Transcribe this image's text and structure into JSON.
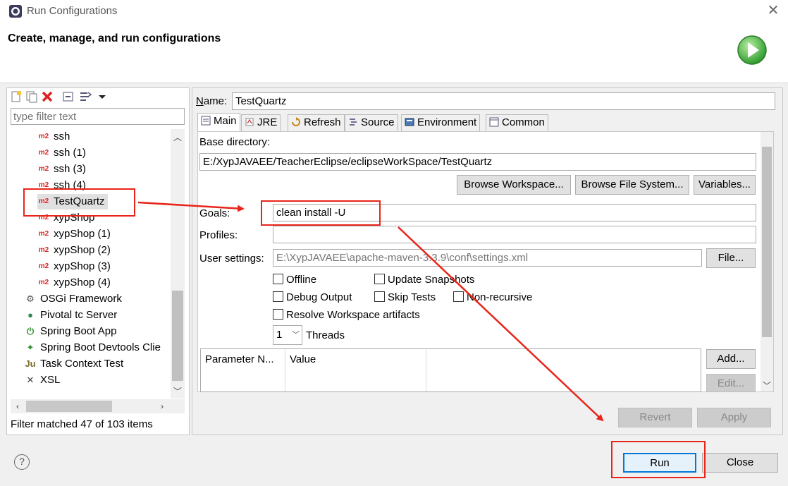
{
  "window": {
    "title": "Run Configurations",
    "header": "Create, manage, and run configurations",
    "close_glyph": "✕"
  },
  "left": {
    "filter_placeholder": "type filter text",
    "filter_status": "Filter matched 47 of 103 items",
    "tree": [
      {
        "label": "ssh",
        "icon": "maven-m2-icon",
        "indent": 1
      },
      {
        "label": "ssh (1)",
        "icon": "maven-m2-icon",
        "indent": 1
      },
      {
        "label": "ssh (3)",
        "icon": "maven-m2-icon",
        "indent": 1
      },
      {
        "label": "ssh (4)",
        "icon": "maven-m2-icon",
        "indent": 1
      },
      {
        "label": "TestQuartz",
        "icon": "maven-m2-icon",
        "indent": 1,
        "selected": true
      },
      {
        "label": "xypShop",
        "icon": "maven-m2-icon",
        "indent": 1
      },
      {
        "label": "xypShop (1)",
        "icon": "maven-m2-icon",
        "indent": 1
      },
      {
        "label": "xypShop (2)",
        "icon": "maven-m2-icon",
        "indent": 1
      },
      {
        "label": "xypShop (3)",
        "icon": "maven-m2-icon",
        "indent": 1
      },
      {
        "label": "xypShop (4)",
        "icon": "maven-m2-icon",
        "indent": 1
      },
      {
        "label": "OSGi Framework",
        "icon": "osgi-icon",
        "indent": 0
      },
      {
        "label": "Pivotal tc Server",
        "icon": "pivotal-icon",
        "indent": 0
      },
      {
        "label": "Spring Boot App",
        "icon": "spring-boot-icon",
        "indent": 0
      },
      {
        "label": "Spring Boot Devtools Clie",
        "icon": "spring-devtools-icon",
        "indent": 0
      },
      {
        "label": "Task Context Test",
        "icon": "junit-icon",
        "indent": 0
      },
      {
        "label": "XSL",
        "icon": "xsl-icon",
        "indent": 0
      }
    ],
    "m2_glyph": "m2"
  },
  "main": {
    "name_label": "Name:",
    "name_value": "TestQuartz",
    "tabs": [
      {
        "label": "Main",
        "icon": "main-tab-icon",
        "active": true
      },
      {
        "label": "JRE",
        "icon": "jre-icon"
      },
      {
        "label": "Refresh",
        "icon": "refresh-icon"
      },
      {
        "label": "Source",
        "icon": "source-icon"
      },
      {
        "label": "Environment",
        "icon": "environment-icon"
      },
      {
        "label": "Common",
        "icon": "common-icon"
      }
    ],
    "base_dir_label": "Base directory:",
    "base_dir_value": "E:/XypJAVAEE/TeacherEclipse/eclipseWorkSpace/TestQuartz",
    "browse_workspace": "Browse Workspace...",
    "browse_fs": "Browse File System...",
    "variables": "Variables...",
    "goals_label": "Goals:",
    "goals_value": "clean install -U",
    "profiles_label": "Profiles:",
    "profiles_value": "",
    "user_settings_label": "User settings:",
    "user_settings_value": "E:\\XypJAVAEE\\apache-maven-3.3.9\\conf\\settings.xml",
    "file_button": "File...",
    "checkboxes": {
      "offline": "Offline",
      "update_snapshots": "Update Snapshots",
      "debug_output": "Debug Output",
      "skip_tests": "Skip Tests",
      "non_recursive": "Non-recursive",
      "resolve_workspace": "Resolve Workspace artifacts"
    },
    "threads_value": "1",
    "threads_label": "Threads",
    "param_col_name": "Parameter N...",
    "param_col_value": "Value",
    "add_button": "Add...",
    "edit_button": "Edit...",
    "revert_button": "Revert",
    "apply_button": "Apply"
  },
  "footer": {
    "help_glyph": "?",
    "run_button": "Run",
    "close_button": "Close"
  },
  "colors": {
    "annotation_red": "#e8251b",
    "m2_red": "#dd2222"
  }
}
